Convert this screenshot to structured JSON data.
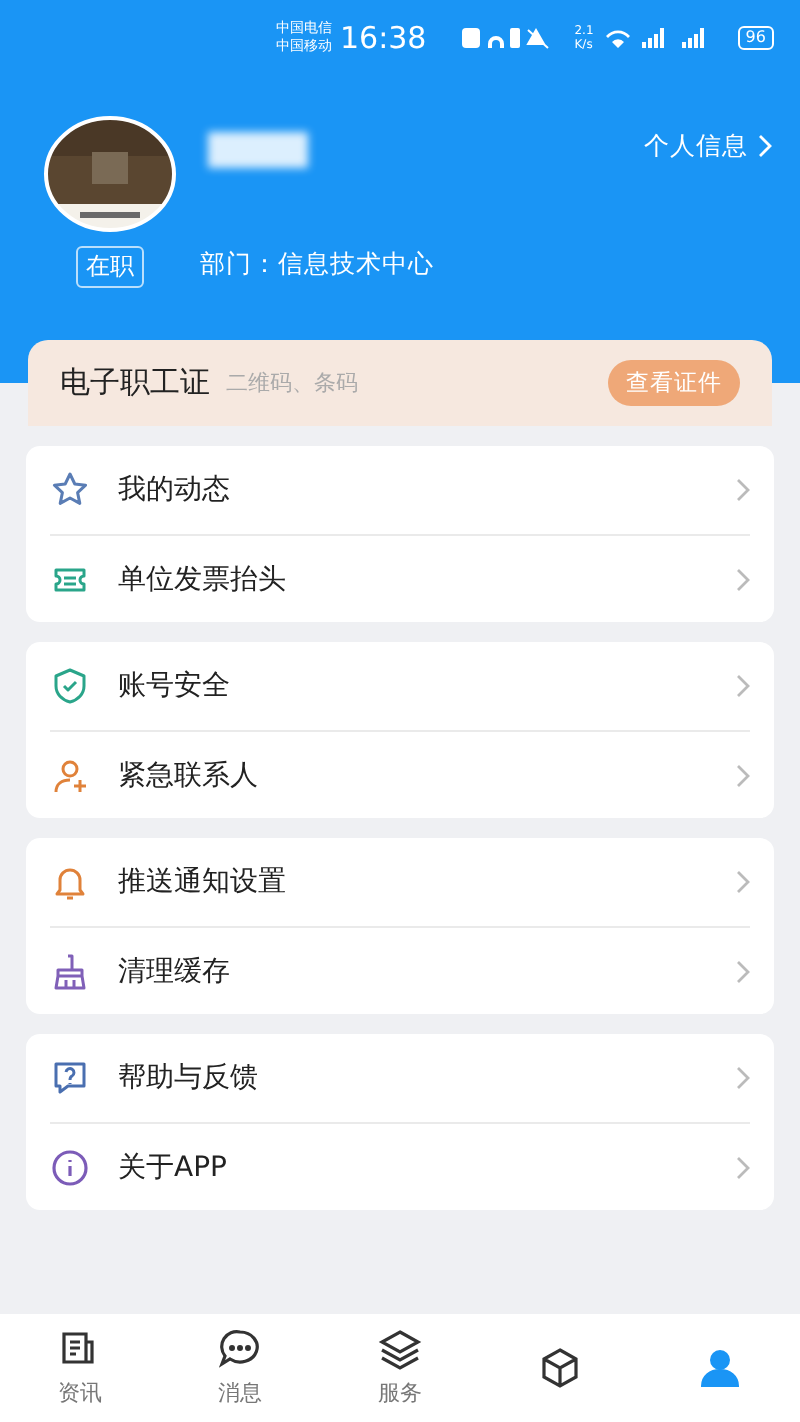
{
  "status_bar": {
    "carriers": [
      "中国电信",
      "中国移动"
    ],
    "time": "16:38",
    "speed": [
      "2.1",
      "K/s"
    ],
    "battery": "96"
  },
  "profile": {
    "status_badge": "在职",
    "department": "部门：信息技术中心",
    "info_link": "个人信息"
  },
  "id_card": {
    "title": "电子职工证",
    "subtitle": "二维码、条码",
    "button": "查看证件"
  },
  "groups": [
    {
      "items": [
        {
          "label": "我的动态"
        },
        {
          "label": "单位发票抬头"
        }
      ]
    },
    {
      "items": [
        {
          "label": "账号安全"
        },
        {
          "label": "紧急联系人"
        }
      ]
    },
    {
      "items": [
        {
          "label": "推送通知设置"
        },
        {
          "label": "清理缓存"
        }
      ]
    },
    {
      "items": [
        {
          "label": "帮助与反馈"
        },
        {
          "label": "关于APP"
        }
      ]
    }
  ],
  "tab_bar": [
    {
      "label": "资讯",
      "selected": false
    },
    {
      "label": "消息",
      "selected": false
    },
    {
      "label": "服务",
      "selected": false
    },
    {
      "selected": false
    },
    {
      "selected": true
    }
  ]
}
